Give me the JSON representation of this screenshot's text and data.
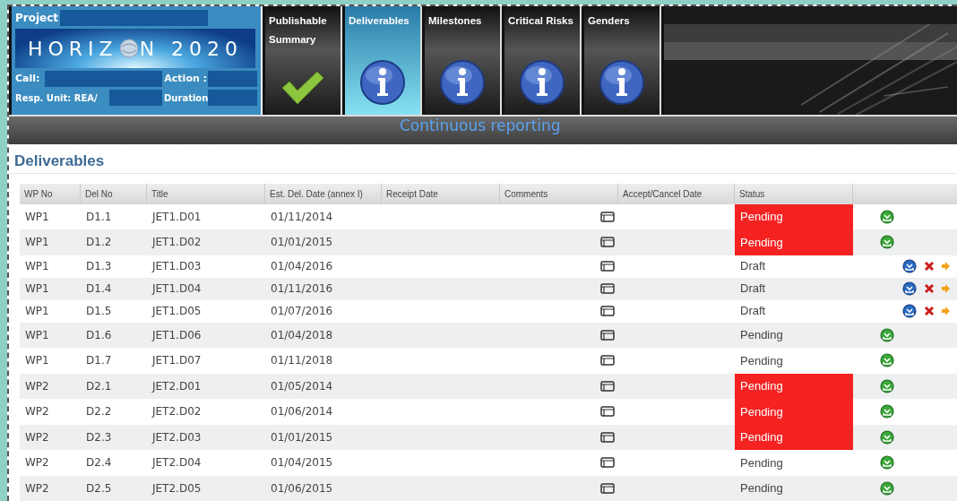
{
  "project_panel": {
    "project_label": "Project",
    "logo": {
      "before": "HORIZ",
      "after": "N 2020"
    },
    "call_label": "Call:",
    "action_label": "Action :",
    "unit_label": "Resp. Unit: REA/",
    "duration_label": "Duration"
  },
  "tabs": [
    {
      "label": "Publishable Summary",
      "kind": "check",
      "selected": false
    },
    {
      "label": "Deliverables",
      "kind": "info",
      "selected": true
    },
    {
      "label": "Milestones",
      "kind": "info",
      "selected": false
    },
    {
      "label": "Critical Risks",
      "kind": "info",
      "selected": false
    },
    {
      "label": "Genders",
      "kind": "info",
      "selected": false
    }
  ],
  "subtitle": "Continuous reporting",
  "section_title": "Deliverables",
  "table": {
    "columns": [
      "WP No",
      "Del No",
      "Title",
      "Est. Del. Date (annex I)",
      "Receipt Date",
      "Comments",
      "Accept/Cancel Date",
      "Status"
    ],
    "rows": [
      {
        "wp": "WP1",
        "del": "D1.1",
        "title": "JET1.D01",
        "date": "01/11/2014",
        "status": "Pending",
        "overdue": true,
        "kind": "submit"
      },
      {
        "wp": "WP1",
        "del": "D1.2",
        "title": "JET1.D02",
        "date": "01/01/2015",
        "status": "Pending",
        "overdue": true,
        "kind": "submit"
      },
      {
        "wp": "WP1",
        "del": "D1.3",
        "title": "JET1.D03",
        "date": "01/04/2016",
        "status": "Draft",
        "overdue": false,
        "kind": "draft"
      },
      {
        "wp": "WP1",
        "del": "D1.4",
        "title": "JET1.D04",
        "date": "01/11/2016",
        "status": "Draft",
        "overdue": false,
        "kind": "draft"
      },
      {
        "wp": "WP1",
        "del": "D1.5",
        "title": "JET1.D05",
        "date": "01/07/2016",
        "status": "Draft",
        "overdue": false,
        "kind": "draft"
      },
      {
        "wp": "WP1",
        "del": "D1.6",
        "title": "JET1.D06",
        "date": "01/04/2018",
        "status": "Pending",
        "overdue": false,
        "kind": "submit"
      },
      {
        "wp": "WP1",
        "del": "D1.7",
        "title": "JET1.D07",
        "date": "01/11/2018",
        "status": "Pending",
        "overdue": false,
        "kind": "submit"
      },
      {
        "wp": "WP2",
        "del": "D2.1",
        "title": "JET2.D01",
        "date": "01/05/2014",
        "status": "Pending",
        "overdue": true,
        "kind": "submit"
      },
      {
        "wp": "WP2",
        "del": "D2.2",
        "title": "JET2.D02",
        "date": "01/06/2014",
        "status": "Pending",
        "overdue": true,
        "kind": "submit"
      },
      {
        "wp": "WP2",
        "del": "D2.3",
        "title": "JET2.D03",
        "date": "01/01/2015",
        "status": "Pending",
        "overdue": true,
        "kind": "submit"
      },
      {
        "wp": "WP2",
        "del": "D2.4",
        "title": "JET2.D04",
        "date": "01/04/2015",
        "status": "Pending",
        "overdue": false,
        "kind": "submit"
      },
      {
        "wp": "WP2",
        "del": "D2.5",
        "title": "JET2.D05",
        "date": "01/06/2015",
        "status": "Pending",
        "overdue": false,
        "kind": "submit"
      }
    ]
  }
}
